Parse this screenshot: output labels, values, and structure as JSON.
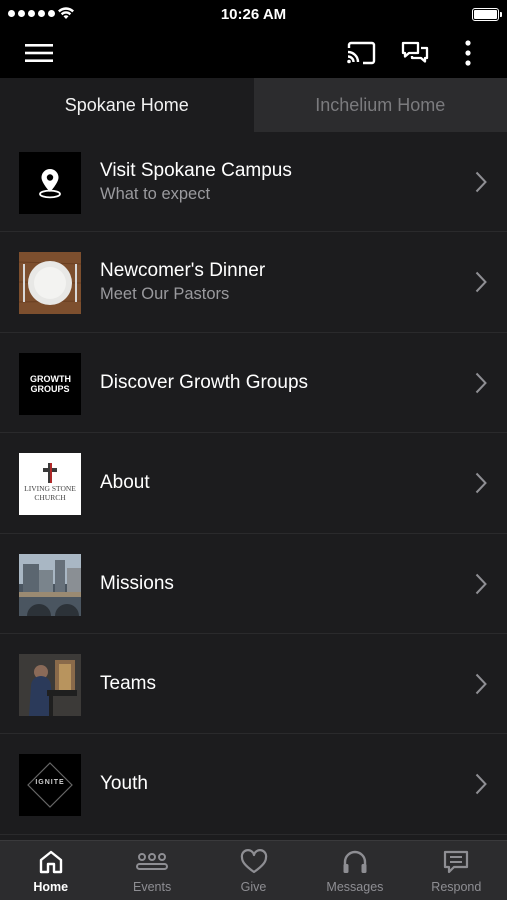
{
  "status_bar": {
    "time": "10:26 AM"
  },
  "tabs": [
    {
      "label": "Spokane Home",
      "active": true
    },
    {
      "label": "Inchelium Home",
      "active": false
    }
  ],
  "thumb_text": {
    "growth": "GROWTH GROUPS",
    "church_line1": "LIVING STONE",
    "church_line2": "CHURCH",
    "ignite": "IGNITE"
  },
  "items": [
    {
      "title": "Visit Spokane Campus",
      "subtitle": "What to expect",
      "icon": "location-pin-icon"
    },
    {
      "title": "Newcomer's Dinner",
      "subtitle": "Meet Our Pastors",
      "icon": "dinner-plate-image"
    },
    {
      "title": "Discover Growth Groups",
      "icon": "growth-groups-logo"
    },
    {
      "title": "About",
      "icon": "church-logo"
    },
    {
      "title": "Missions",
      "icon": "city-bridge-image"
    },
    {
      "title": "Teams",
      "icon": "musician-image"
    },
    {
      "title": "Youth",
      "icon": "ignite-logo"
    }
  ],
  "tab_bar": [
    {
      "label": "Home",
      "icon": "home-icon",
      "active": true
    },
    {
      "label": "Events",
      "icon": "people-group-icon",
      "active": false
    },
    {
      "label": "Give",
      "icon": "heart-icon",
      "active": false
    },
    {
      "label": "Messages",
      "icon": "headphones-icon",
      "active": false
    },
    {
      "label": "Respond",
      "icon": "message-icon",
      "active": false
    }
  ],
  "colors": {
    "background": "#1c1c1e",
    "header": "#000000",
    "tab_inactive_bg": "#2c2c2e",
    "tab_inactive_text": "#7b7b7e",
    "subtitle": "#9a9a9e"
  }
}
